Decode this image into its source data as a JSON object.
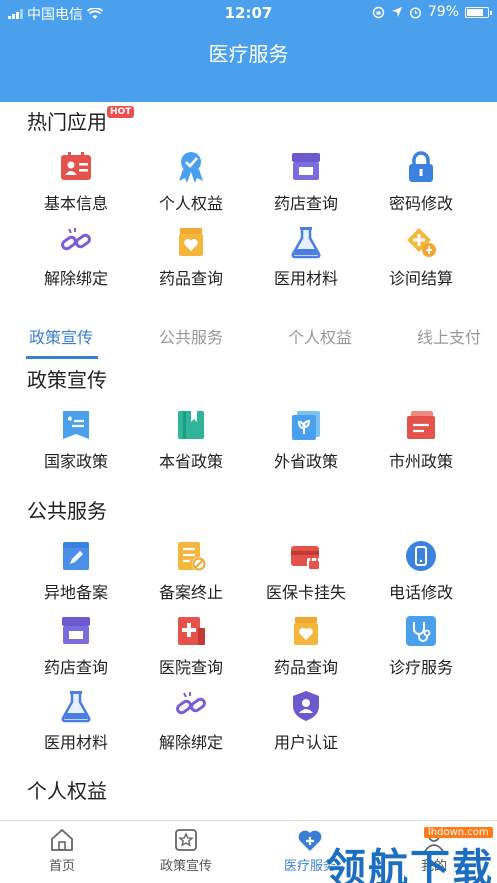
{
  "status_bar": {
    "carrier": "中国电信",
    "time": "12:07",
    "battery": "79%",
    "battery_level": 0.79
  },
  "header": {
    "title": "医疗服务"
  },
  "hot_section": {
    "title": "热门应用",
    "badge": "HOT",
    "items": [
      {
        "label": "基本信息",
        "icon": "id-card-icon"
      },
      {
        "label": "个人权益",
        "icon": "badge-icon"
      },
      {
        "label": "药店查询",
        "icon": "store-icon"
      },
      {
        "label": "密码修改",
        "icon": "lock-icon"
      },
      {
        "label": "解除绑定",
        "icon": "unlink-icon"
      },
      {
        "label": "药品查询",
        "icon": "medicine-box-icon"
      },
      {
        "label": "医用材料",
        "icon": "flask-icon"
      },
      {
        "label": "诊间结算",
        "icon": "settle-icon"
      }
    ]
  },
  "tabs": [
    "政策宣传",
    "公共服务",
    "个人权益",
    "线上支付"
  ],
  "active_tab": 0,
  "policy_section": {
    "title": "政策宣传",
    "items": [
      {
        "label": "国家政策",
        "icon": "national-policy-icon"
      },
      {
        "label": "本省政策",
        "icon": "book-icon"
      },
      {
        "label": "外省政策",
        "icon": "sprout-icon"
      },
      {
        "label": "市州政策",
        "icon": "folder-icon"
      }
    ]
  },
  "public_section": {
    "title": "公共服务",
    "items": [
      {
        "label": "异地备案",
        "icon": "edit-box-icon"
      },
      {
        "label": "备案终止",
        "icon": "doc-stop-icon"
      },
      {
        "label": "医保卡挂失",
        "icon": "card-lock-icon"
      },
      {
        "label": "电话修改",
        "icon": "phone-icon"
      },
      {
        "label": "药店查询",
        "icon": "store-icon"
      },
      {
        "label": "医院查询",
        "icon": "hospital-icon"
      },
      {
        "label": "药品查询",
        "icon": "medicine-box-icon"
      },
      {
        "label": "诊疗服务",
        "icon": "stethoscope-icon"
      },
      {
        "label": "医用材料",
        "icon": "flask-icon"
      },
      {
        "label": "解除绑定",
        "icon": "unlink-icon"
      },
      {
        "label": "用户认证",
        "icon": "user-shield-icon"
      }
    ]
  },
  "rights_section": {
    "title": "个人权益"
  },
  "bottom_nav": [
    {
      "label": "首页",
      "icon": "home-icon"
    },
    {
      "label": "政策宣传",
      "icon": "star-icon"
    },
    {
      "label": "医疗服务",
      "icon": "heart-plus-icon"
    },
    {
      "label": "我的",
      "icon": "user-icon"
    }
  ],
  "active_nav": 2,
  "watermark": {
    "text": "领航下载",
    "url": "lhdown.com"
  },
  "colors": {
    "header": "#4aa0ec",
    "accent": "#3b7fd4",
    "hot": "#ef4e4e"
  }
}
